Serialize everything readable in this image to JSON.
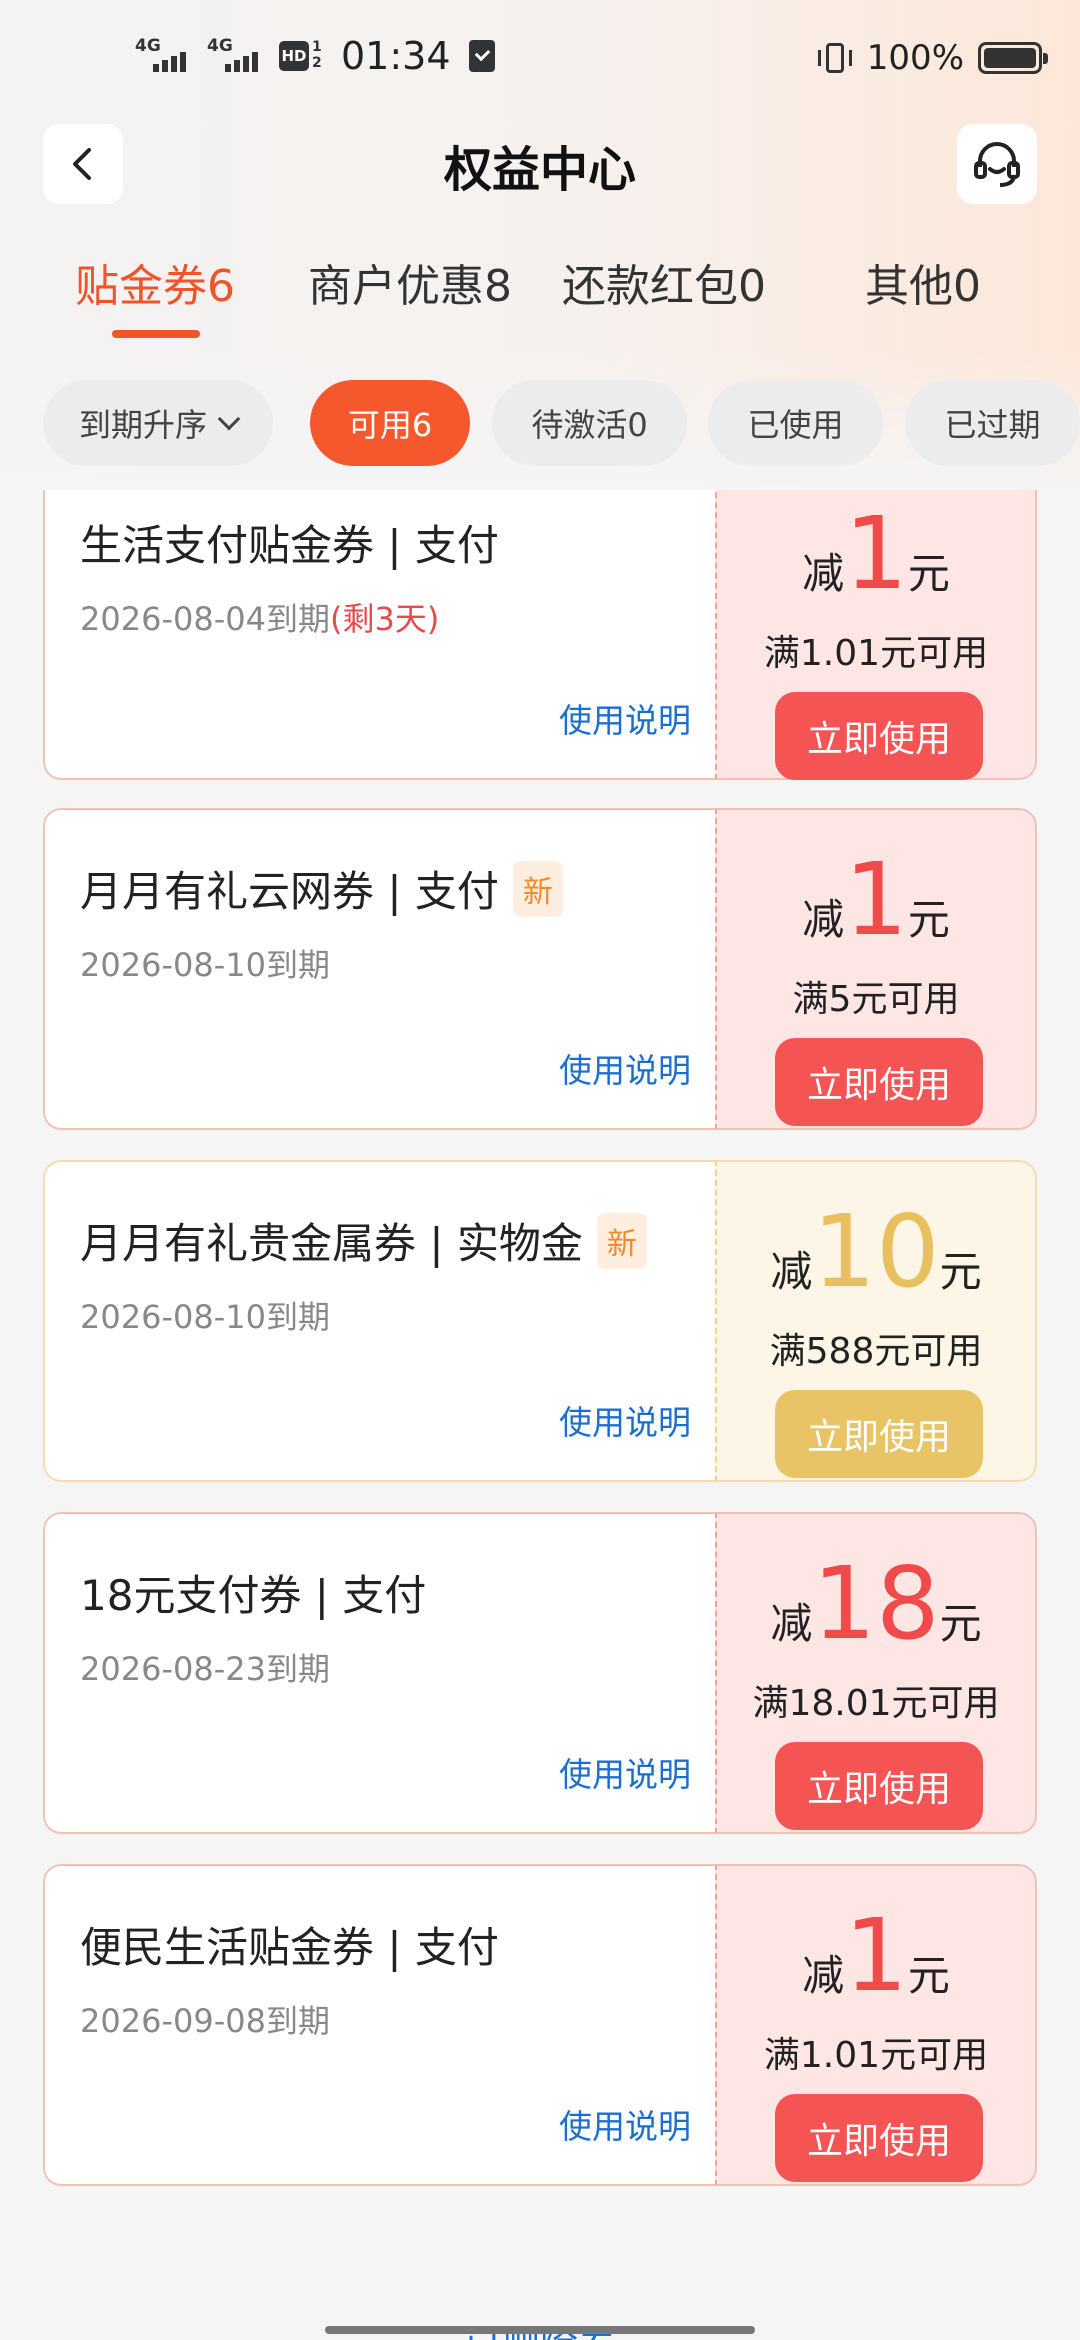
{
  "status_bar": {
    "net1": "4G",
    "net2": "4G",
    "hd": "HD",
    "hd_frac": "1 2",
    "time": "01:34",
    "battery": "100%"
  },
  "header": {
    "title": "权益中心"
  },
  "tabs": [
    {
      "label": "贴金券6",
      "active": true
    },
    {
      "label": "商户优惠8",
      "active": false
    },
    {
      "label": "还款红包0",
      "active": false
    },
    {
      "label": "其他0",
      "active": false
    }
  ],
  "filters": [
    {
      "label": "到期升序",
      "dropdown": true
    },
    {
      "label": "可用6",
      "active": true
    },
    {
      "label": "待激活0"
    },
    {
      "label": "已使用"
    },
    {
      "label": "已过期"
    }
  ],
  "coupons": [
    {
      "name": "生活支付贴金券 | 支付",
      "new_tag": "",
      "expiry": "2026-08-04到期",
      "remaining": "(剩3天)",
      "usage": "使用说明",
      "prefix": "减",
      "amount": "1",
      "suffix": "元",
      "condition": "满1.01元可用",
      "button": "立即使用",
      "style": "red"
    },
    {
      "name": "月月有礼云网券 | 支付",
      "new_tag": "新",
      "expiry": "2026-08-10到期",
      "remaining": "",
      "usage": "使用说明",
      "prefix": "减",
      "amount": "1",
      "suffix": "元",
      "condition": "满5元可用",
      "button": "立即使用",
      "style": "red"
    },
    {
      "name": "月月有礼贵金属券 | 实物金",
      "new_tag": "新",
      "expiry": "2026-08-10到期",
      "remaining": "",
      "usage": "使用说明",
      "prefix": "减",
      "amount": "10",
      "suffix": "元",
      "condition": "满588元可用",
      "button": "立即使用",
      "style": "gold"
    },
    {
      "name": "18元支付券 | 支付",
      "new_tag": "",
      "expiry": "2026-08-23到期",
      "remaining": "",
      "usage": "使用说明",
      "prefix": "减",
      "amount": "18",
      "suffix": "元",
      "condition": "满18.01元可用",
      "button": "立即使用",
      "style": "red"
    },
    {
      "name": "便民生活贴金券 | 支付",
      "new_tag": "",
      "expiry": "2026-09-08到期",
      "remaining": "",
      "usage": "使用说明",
      "prefix": "减",
      "amount": "1",
      "suffix": "元",
      "condition": "满1.01元可用",
      "button": "立即使用",
      "style": "red"
    }
  ],
  "footer": {
    "deleted_link": "已删除券"
  },
  "colors": {
    "accent": "#f0542a",
    "coupon_red": "#f55454",
    "coupon_gold": "#e8c466",
    "link_blue": "#1b6fd1"
  }
}
